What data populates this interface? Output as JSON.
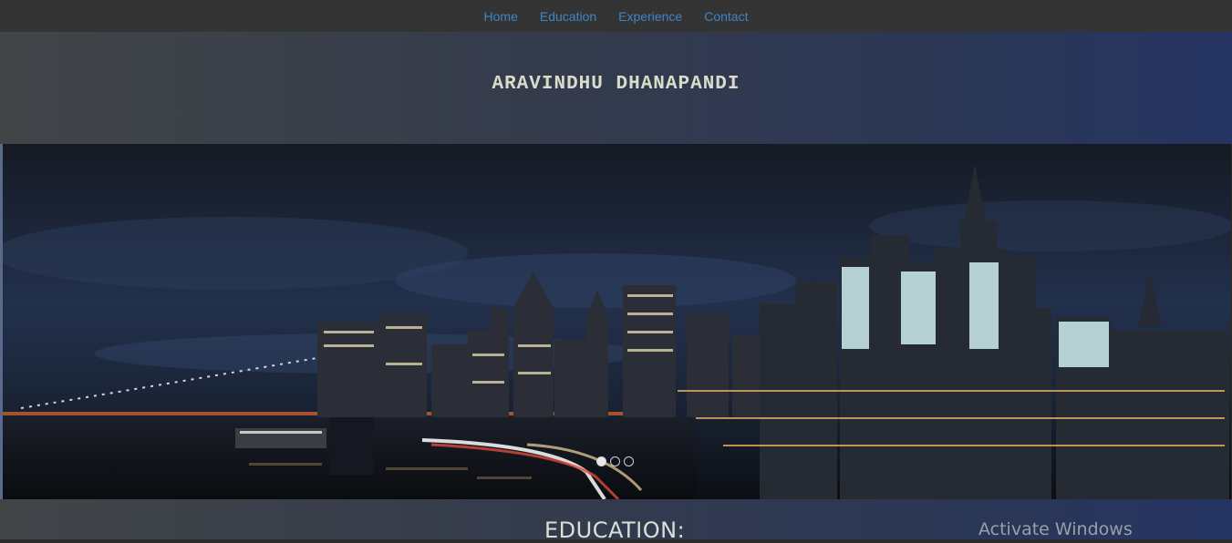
{
  "nav": {
    "items": [
      {
        "label": "Home"
      },
      {
        "label": "Education"
      },
      {
        "label": "Experience"
      },
      {
        "label": "Contact"
      }
    ]
  },
  "header": {
    "title": "ARAVINDHU DHANAPANDI"
  },
  "carousel": {
    "image": "night-city-skyline",
    "active_slide": 1,
    "slide_count": 3
  },
  "section": {
    "heading": "EDUCATION:"
  },
  "overlay": {
    "watermark": "Activate Windows"
  }
}
